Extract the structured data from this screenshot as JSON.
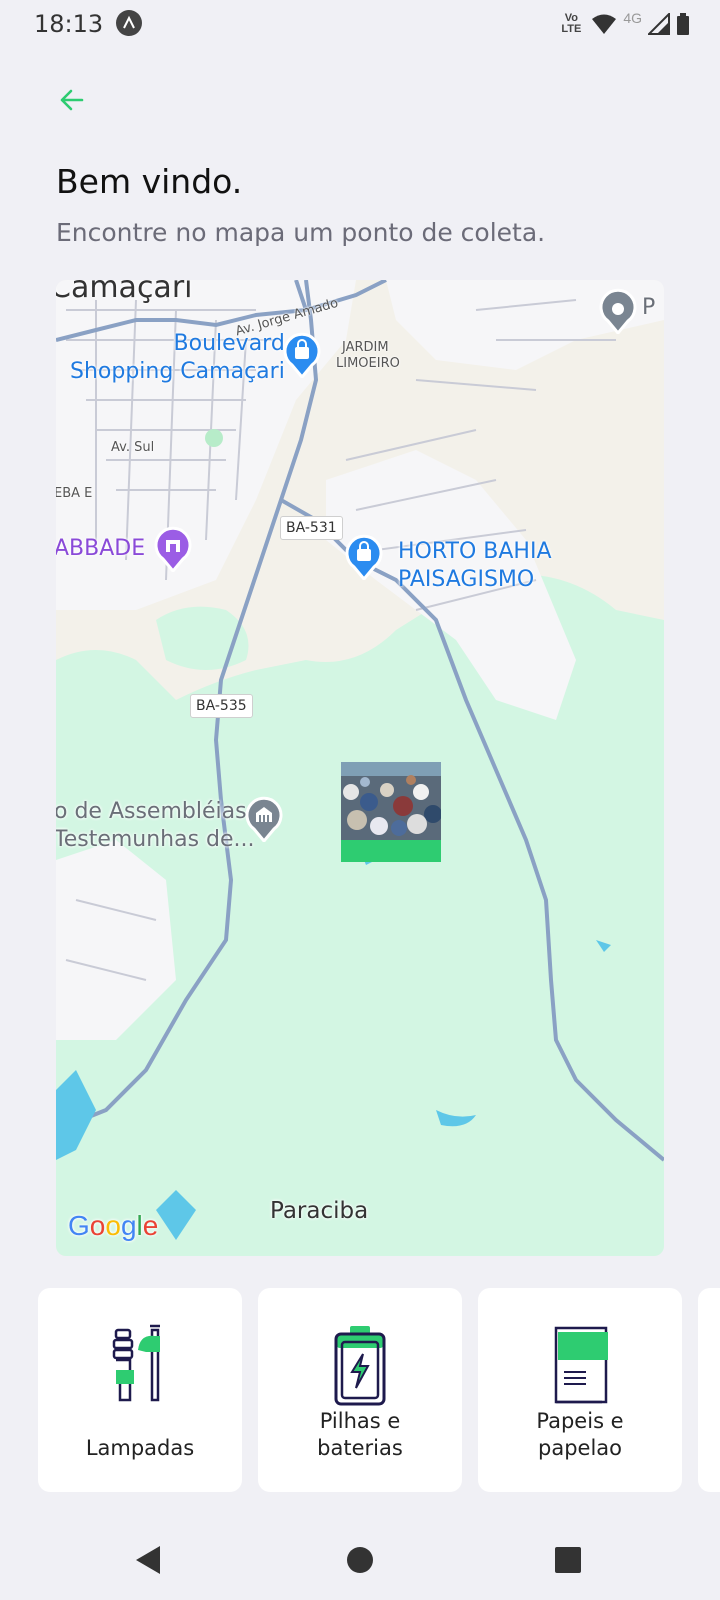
{
  "status_bar": {
    "time": "18:13",
    "volte_top": "Vo",
    "volte_bottom": "LTE",
    "network": "4G"
  },
  "header": {
    "title": "Bem vindo.",
    "subtitle": "Encontre no mapa um ponto de coleta."
  },
  "map": {
    "city_label": "Camaçari",
    "street_jorge_amado": "Av. Jorge Amado",
    "poi_boulevard_line1": "Boulevard",
    "poi_boulevard_line2": "Shopping Camaçari",
    "district_jardim_line1": "JARDIM",
    "district_jardim_line2": "LIMOEIRO",
    "street_sul": "Av. Sul",
    "partial_eba": "EBA E",
    "poi_abbade": "ABBADE",
    "road_ba531": "BA-531",
    "poi_horto_line1": "HORTO BAHIA",
    "poi_horto_line2": "PAISAGISMO",
    "road_ba535": "BA-535",
    "poi_assembleias_line1": "o de Assembléias",
    "poi_assembleias_line2": "Testemunhas de...",
    "poi_top_right_partial": "P",
    "town_paraciba": "Paraciba",
    "google_logo": {
      "G": "G",
      "o1": "o",
      "o2": "o",
      "g": "g",
      "l": "l",
      "e": "e"
    },
    "colors": {
      "park_green": "#d2f5e3",
      "road_blue": "#8aa1c4",
      "water": "#5ec7e8"
    }
  },
  "categories": [
    {
      "label": "Lampadas",
      "icon": "lamp-icon"
    },
    {
      "label": "Pilhas e baterias",
      "line1": "Pilhas e",
      "line2": "baterias",
      "icon": "battery-icon"
    },
    {
      "label": "Papeis e papelao",
      "line1": "Papeis e",
      "line2": "papelao",
      "icon": "paper-icon"
    }
  ],
  "colors": {
    "accent": "#2ecc71",
    "icon_dark": "#1e1a4d"
  }
}
